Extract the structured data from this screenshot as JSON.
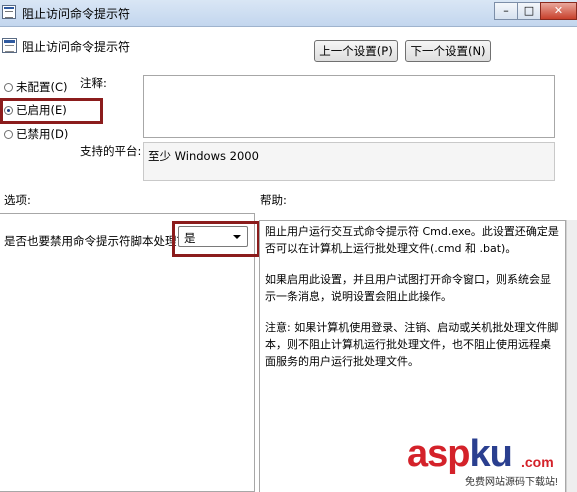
{
  "window": {
    "title": "阻止访问命令提示符",
    "buttons": {
      "minimize": "–",
      "maximize": "□",
      "close": "✕"
    }
  },
  "header": {
    "title": "阻止访问命令提示符",
    "prev_button": "上一个设置(P)",
    "next_button": "下一个设置(N)"
  },
  "state_options": [
    {
      "label": "未配置(C)",
      "selected": false
    },
    {
      "label": "已启用(E)",
      "selected": true
    },
    {
      "label": "已禁用(D)",
      "selected": false
    }
  ],
  "comment": {
    "label": "注释:",
    "value": ""
  },
  "platform": {
    "label": "支持的平台:",
    "value": "至少 Windows 2000"
  },
  "options": {
    "section_label": "选项:",
    "question": "是否也要禁用命令提示符脚本处理？",
    "select_value": "是"
  },
  "help": {
    "section_label": "帮助:",
    "paragraphs": [
      "阻止用户运行交互式命令提示符 Cmd.exe。此设置还确定是否可以在计算机上运行批处理文件(.cmd 和 .bat)。",
      "如果启用此设置，并且用户试图打开命令窗口，则系统会显示一条消息，说明设置会阻止此操作。",
      "注意: 如果计算机使用登录、注销、启动或关机批处理文件脚本，则不阻止计算机运行批处理文件，也不阻止使用远程桌面服务的用户运行批处理文件。"
    ]
  },
  "watermark": {
    "brand_red1": "asp",
    "brand_blue": "ku",
    "dot": ".com",
    "subtitle": "免费网站源码下载站!"
  },
  "colors": {
    "highlight_border": "#8b1c1c",
    "watermark_red": "#d4222a",
    "watermark_blue": "#2a3f8f"
  }
}
